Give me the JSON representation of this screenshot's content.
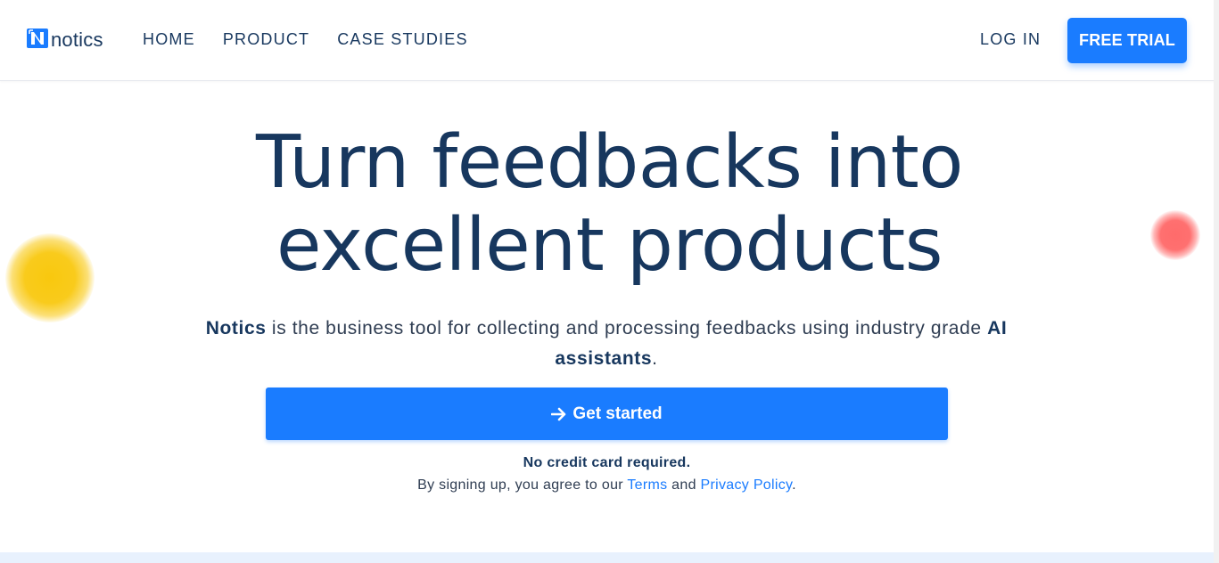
{
  "nav": {
    "logo_text": "notics",
    "links": [
      "HOME",
      "PRODUCT",
      "CASE STUDIES"
    ],
    "login_label": "LOG IN",
    "trial_label": "FREE TRIAL"
  },
  "hero": {
    "title_line1": "Turn feedbacks into",
    "title_line2": "excellent products",
    "subtitle_brand": "Notics",
    "subtitle_text": " is the business tool for collecting and processing feedbacks using industry grade ",
    "subtitle_emphasis": "AI assistants",
    "subtitle_end": ".",
    "cta_label": "Get started",
    "cta_icon": "arrow-right-icon",
    "no_credit_card": "No credit card required.",
    "agree_prefix": "By signing up, you agree to our ",
    "terms_label": "Terms",
    "agree_and": " and ",
    "privacy_label": "Privacy Policy",
    "agree_end": "."
  },
  "colors": {
    "brand_blue": "#1a7cff",
    "navy_text": "#17375e",
    "accent_yellow": "#f9c80e",
    "accent_red": "#ff6b6b"
  }
}
